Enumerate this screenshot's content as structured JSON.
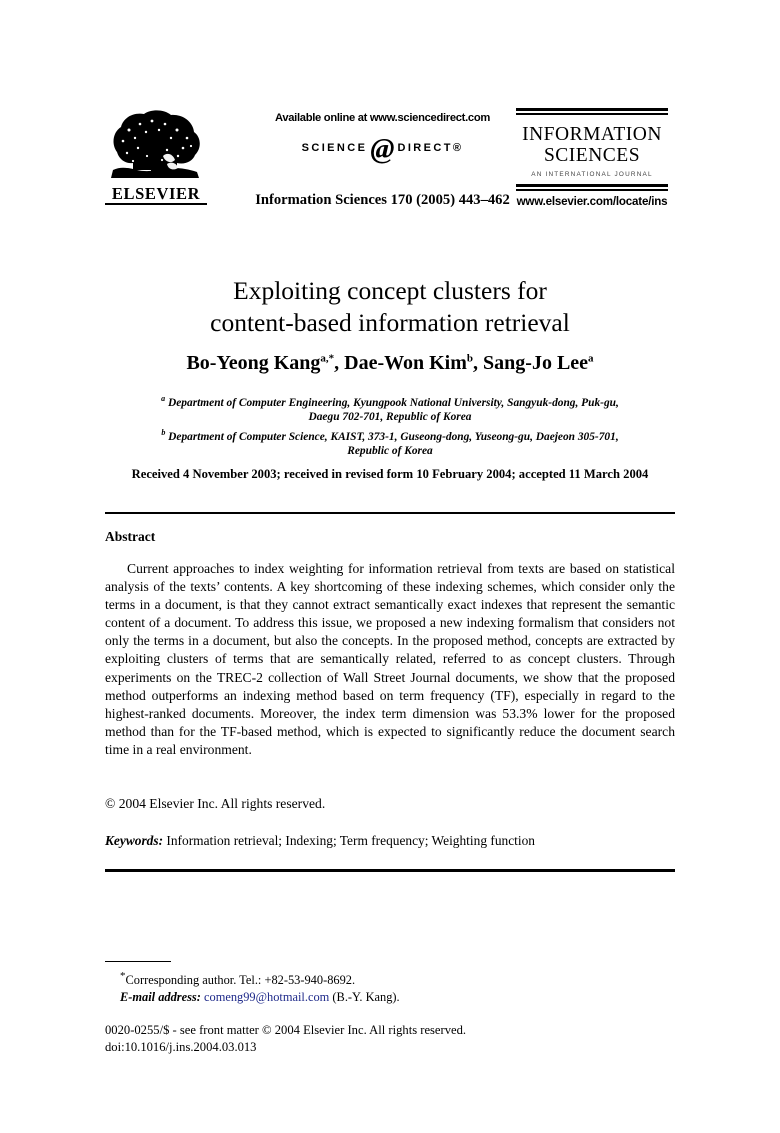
{
  "masthead": {
    "publisher_name": "ELSEVIER",
    "publisher_logo_icon": "elsevier-tree-icon",
    "available_online": "Available online at www.sciencedirect.com",
    "sciencedirect_left": "SCIENCE",
    "sciencedirect_at": "@",
    "sciencedirect_right": "DIRECT®",
    "citation": "Information Sciences 170 (2005) 443–462",
    "journal_title_line1": "INFORMATION",
    "journal_title_line2": "SCIENCES",
    "journal_subtitle": "AN INTERNATIONAL JOURNAL",
    "journal_url": "www.elsevier.com/locate/ins"
  },
  "article": {
    "title_line1": "Exploiting concept clusters for",
    "title_line2": "content-based information retrieval",
    "authors": [
      {
        "name": "Bo-Yeong Kang",
        "marks": "a,*"
      },
      {
        "name": "Dae-Won Kim",
        "marks": "b"
      },
      {
        "name": "Sang-Jo Lee",
        "marks": "a"
      }
    ],
    "affiliations": [
      {
        "mark": "a",
        "line1": "Department of Computer Engineering, Kyungpook National University, Sangyuk-dong, Puk-gu,",
        "line2": "Daegu 702-701, Republic of Korea"
      },
      {
        "mark": "b",
        "line1": "Department of Computer Science, KAIST, 373-1, Guseong-dong, Yuseong-gu, Daejeon 305-701,",
        "line2": "Republic of Korea"
      }
    ],
    "history": "Received 4 November 2003; received in revised form 10 February 2004; accepted 11 March 2004"
  },
  "abstract": {
    "heading": "Abstract",
    "text": "Current approaches to index weighting for information retrieval from texts are based on statistical analysis of the texts’ contents. A key shortcoming of these indexing schemes, which consider only the terms in a document, is that they cannot extract semantically exact indexes that represent the semantic content of a document. To address this issue, we proposed a new indexing formalism that considers not only the terms in a document, but also the concepts. In the proposed method, concepts are extracted by exploiting clusters of terms that are semantically related, referred to as concept clusters. Through experiments on the TREC-2 collection of Wall Street Journal documents, we show that the proposed method outperforms an indexing method based on term frequency (TF), especially in regard to the highest-ranked documents. Moreover, the index term dimension was 53.3% lower for the proposed method than for the TF-based method, which is expected to significantly reduce the document search time in a real environment.",
    "copyright": "© 2004 Elsevier Inc. All rights reserved."
  },
  "keywords": {
    "label": "Keywords:",
    "value": "Information retrieval; Indexing; Term frequency; Weighting function"
  },
  "footnotes": {
    "corresponding_mark": "*",
    "corresponding_author": "Corresponding author. Tel.: +82-53-940-8692.",
    "email_label": "E-mail address:",
    "email_address": "comeng99@hotmail.com",
    "email_attribution": "(B.-Y. Kang)."
  },
  "imprint": {
    "line1": "0020-0255/$ - see front matter © 2004 Elsevier Inc. All rights reserved.",
    "line2": "doi:10.1016/j.ins.2004.03.013"
  },
  "colors": {
    "link": "#1f2a8a",
    "text": "#000000",
    "background": "#ffffff"
  }
}
